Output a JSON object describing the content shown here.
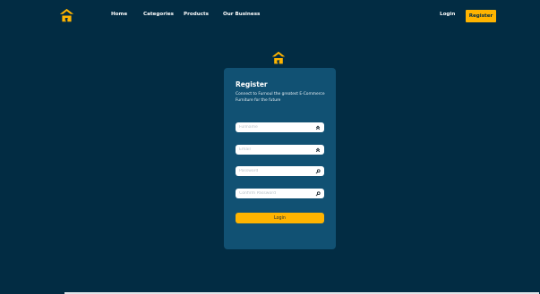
{
  "nav": {
    "links": [
      "Home",
      "Categories",
      "Products",
      "Our Business"
    ],
    "login_label": "Login",
    "register_label": "Register"
  },
  "card": {
    "title": "Register",
    "subtitle": "Connect to Furnoul the greatest E-Commerce Furniture for the future",
    "fields": {
      "fullname_placeholder": "Fullname",
      "email_placeholder": "Email",
      "password_placeholder": "Password",
      "confirm_password_placeholder": "Confirm Password"
    },
    "submit_label": "Login"
  },
  "colors": {
    "background": "#022c43",
    "card": "#115173",
    "accent": "#ffb400"
  },
  "icons": {
    "logo": "house-logo-icon",
    "fullname": "double-chevron-up-icon",
    "email": "double-chevron-up-icon",
    "password": "key-icon",
    "confirm_password": "key-icon"
  }
}
